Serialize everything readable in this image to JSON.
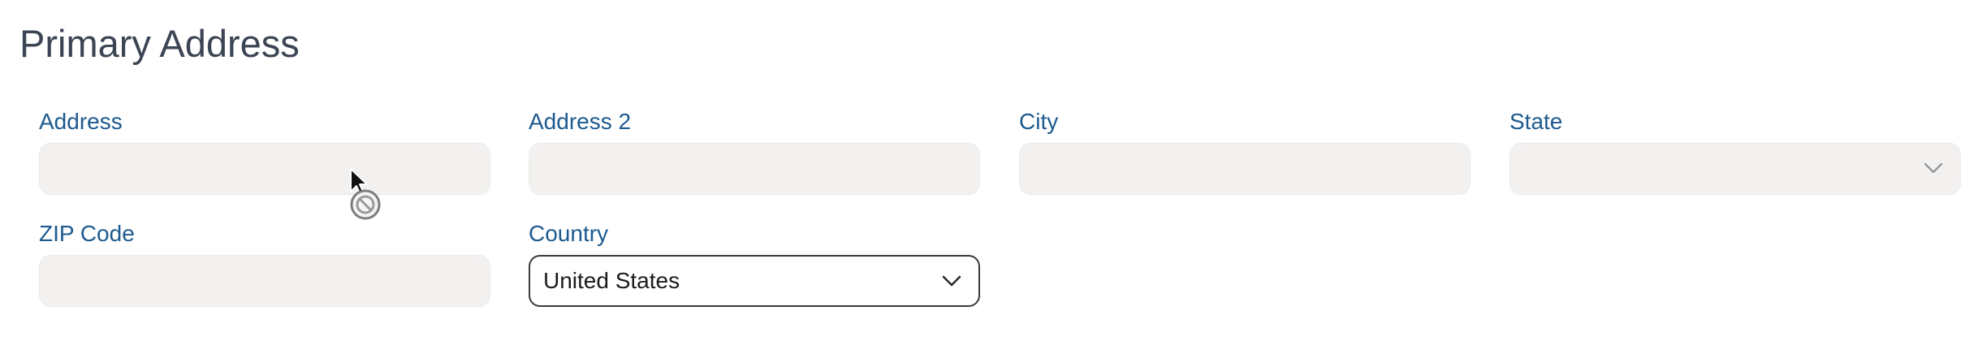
{
  "section": {
    "title": "Primary Address"
  },
  "fields": {
    "address": {
      "label": "Address",
      "value": ""
    },
    "address2": {
      "label": "Address 2",
      "value": ""
    },
    "city": {
      "label": "City",
      "value": ""
    },
    "state": {
      "label": "State",
      "value": ""
    },
    "zip": {
      "label": "ZIP Code",
      "value": ""
    },
    "country": {
      "label": "Country",
      "value": "United States"
    }
  },
  "icons": {
    "state_dropdown": "chevron-down-icon",
    "country_dropdown": "chevron-down-icon",
    "cursor": "not-allowed-cursor-icon"
  },
  "colors": {
    "label": "#1d5a8f",
    "title": "#3c4554",
    "disabled_field": "#f2f1f0",
    "active_border": "#3a3a3a"
  }
}
